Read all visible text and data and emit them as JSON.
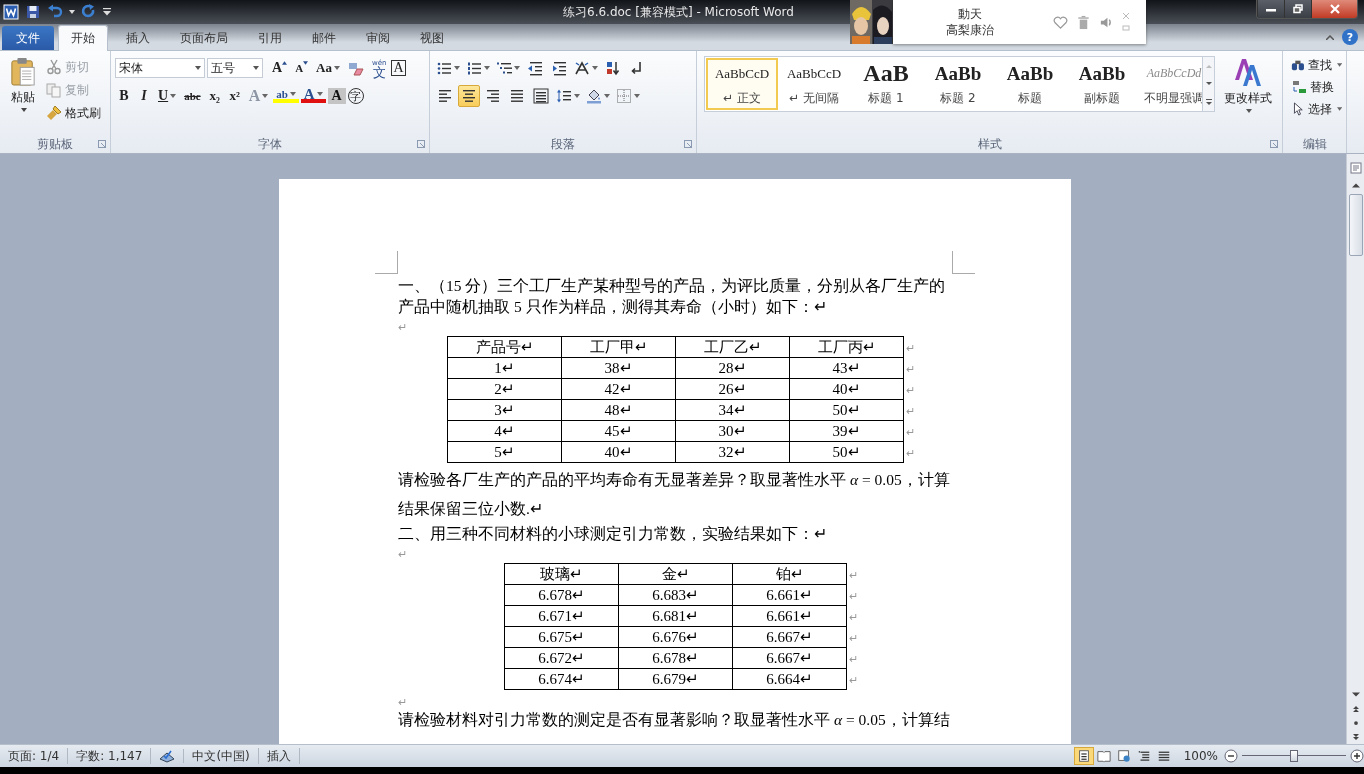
{
  "title_bar": {
    "title": "练习6.6.doc [兼容模式]  -  Microsoft Word"
  },
  "now_playing": {
    "title": "動天",
    "artist": "高梨康治"
  },
  "tabs": [
    {
      "label": "文件",
      "kind": "file",
      "selected": false
    },
    {
      "label": "开始",
      "kind": "tab",
      "selected": true
    },
    {
      "label": "插入",
      "kind": "tab",
      "selected": false
    },
    {
      "label": "页面布局",
      "kind": "tab",
      "selected": false
    },
    {
      "label": "引用",
      "kind": "tab",
      "selected": false
    },
    {
      "label": "邮件",
      "kind": "tab",
      "selected": false
    },
    {
      "label": "审阅",
      "kind": "tab",
      "selected": false
    },
    {
      "label": "视图",
      "kind": "tab",
      "selected": false
    }
  ],
  "help": "?",
  "clipboard": {
    "paste": "粘贴",
    "group": "剪贴板",
    "items": [
      {
        "label": "剪切",
        "kind": "cut",
        "disabled": true
      },
      {
        "label": "复制",
        "kind": "copy",
        "disabled": true
      },
      {
        "label": "格式刷",
        "kind": "painter",
        "disabled": false
      }
    ]
  },
  "font": {
    "family": "宋体",
    "size": "五号",
    "group": "字体",
    "row1": [
      {
        "label": "A",
        "kind": "grow"
      },
      {
        "label": "A",
        "kind": "shrink"
      },
      {
        "label": "Aa",
        "kind": "case"
      },
      {
        "kind": "clear"
      },
      {
        "label": "文",
        "ruby": "wén",
        "kind": "phonetic"
      },
      {
        "label": "A",
        "kind": "border"
      }
    ],
    "row2": [
      {
        "label": "B",
        "kind": "bold"
      },
      {
        "label": "I",
        "kind": "italic"
      },
      {
        "label": "U",
        "kind": "underline"
      },
      {
        "label": "abc",
        "kind": "strike"
      },
      {
        "label": "x₂",
        "kind": "sub"
      },
      {
        "label": "x²",
        "kind": "sup"
      },
      {
        "label": "A",
        "kind": "effect"
      },
      {
        "label": "ab",
        "kind": "highlight"
      },
      {
        "label": "A",
        "kind": "color"
      },
      {
        "label": "A",
        "kind": "shade"
      },
      {
        "label": "字",
        "kind": "enclose"
      }
    ]
  },
  "paragraph": {
    "group": "段落",
    "row1": [
      {
        "kind": "bullets"
      },
      {
        "kind": "numbering"
      },
      {
        "kind": "multilevel"
      },
      {
        "kind": "outdent"
      },
      {
        "kind": "indent"
      },
      {
        "kind": "asian"
      },
      {
        "kind": "sort"
      },
      {
        "kind": "marks"
      }
    ],
    "alignments": [
      {
        "kind": "left",
        "selected": false
      },
      {
        "kind": "center",
        "selected": true
      },
      {
        "kind": "right",
        "selected": false
      },
      {
        "kind": "justify",
        "selected": false
      },
      {
        "kind": "distribute",
        "selected": false
      }
    ],
    "row2": [
      {
        "kind": "linespacing"
      },
      {
        "kind": "shading"
      },
      {
        "kind": "borders"
      }
    ]
  },
  "styles": {
    "group": "样式",
    "change": "更改样式",
    "items": [
      {
        "preview": "AaBbCcD",
        "name": "↵ 正文",
        "kind": "normal",
        "selected": true
      },
      {
        "preview": "AaBbCcD",
        "name": "↵ 无间隔",
        "kind": "normal",
        "selected": false
      },
      {
        "preview": "AaB",
        "name": "标题 1",
        "kind": "title1",
        "selected": false
      },
      {
        "preview": "AaBb",
        "name": "标题 2",
        "kind": "title2",
        "selected": false
      },
      {
        "preview": "AaBb",
        "name": "标题",
        "kind": "title2",
        "selected": false
      },
      {
        "preview": "AaBb",
        "name": "副标题",
        "kind": "title2",
        "selected": false
      },
      {
        "preview": "AaBbCcDd",
        "name": "不明显强调",
        "kind": "subtle",
        "selected": false
      }
    ]
  },
  "editing": {
    "group": "编辑",
    "items": [
      {
        "label": "查找",
        "kind": "find"
      },
      {
        "label": "替换",
        "kind": "replace"
      },
      {
        "label": "选择",
        "kind": "select"
      }
    ]
  },
  "document": [
    {
      "kind": "para",
      "text": "一、（15 分）三个工厂生产某种型号的产品，为评比质量，分别从各厂生产的产品中随机抽取 5 只作为样品，测得其寿命（小时）如下：↵"
    },
    {
      "kind": "empty",
      "text": "↵"
    },
    {
      "kind": "table",
      "header": [
        "产品号↵",
        "工厂甲↵",
        "工厂乙↵",
        "工厂丙↵"
      ],
      "header_end": "↵",
      "rows": [
        {
          "cells": [
            "1↵",
            "38↵",
            "28↵",
            "43↵"
          ],
          "end": "↵"
        },
        {
          "cells": [
            "2↵",
            "42↵",
            "26↵",
            "40↵"
          ],
          "end": "↵"
        },
        {
          "cells": [
            "3↵",
            "48↵",
            "34↵",
            "50↵"
          ],
          "end": "↵"
        },
        {
          "cells": [
            "4↵",
            "45↵",
            "30↵",
            "39↵"
          ],
          "end": "↵"
        },
        {
          "cells": [
            "5↵",
            "40↵",
            "32↵",
            "50↵"
          ],
          "end": "↵"
        }
      ]
    },
    {
      "kind": "formula",
      "text": "请检验各厂生产的产品的平均寿命有无显著差异？取显著性水平 *α* = 0.05，计算结果保留三位小数.↵"
    },
    {
      "kind": "para",
      "text": "二、用三种不同材料的小球测定引力常数，实验结果如下：↵"
    },
    {
      "kind": "empty",
      "text": "↵"
    },
    {
      "kind": "table",
      "header": [
        "玻璃↵",
        "金↵",
        "铂↵"
      ],
      "header_end": "↵",
      "rows": [
        {
          "cells": [
            "6.678↵",
            "6.683↵",
            "6.661↵"
          ],
          "end": "↵"
        },
        {
          "cells": [
            "6.671↵",
            "6.681↵",
            "6.661↵"
          ],
          "end": "↵"
        },
        {
          "cells": [
            "6.675↵",
            "6.676↵",
            "6.667↵"
          ],
          "end": "↵"
        },
        {
          "cells": [
            "6.672↵",
            "6.678↵",
            "6.667↵"
          ],
          "end": "↵"
        },
        {
          "cells": [
            "6.674↵",
            "6.679↵",
            "6.664↵"
          ],
          "end": "↵"
        }
      ]
    },
    {
      "kind": "empty",
      "text": "↵"
    },
    {
      "kind": "para",
      "text": "请检验材料对引力常数的测定是否有显著影响？取显著性水平 *α* = 0.05，计算结"
    }
  ],
  "status_bar": {
    "page": "页面: 1/4",
    "words": "字数: 1,147",
    "language": "中文(中国)",
    "mode": "插入",
    "views": [
      {
        "kind": "print",
        "selected": true
      },
      {
        "kind": "reading",
        "selected": false
      },
      {
        "kind": "web",
        "selected": false
      },
      {
        "kind": "outline",
        "selected": false
      },
      {
        "kind": "draft",
        "selected": false
      }
    ],
    "zoom": "100%",
    "zoom_slider": {
      "level": 0.5
    }
  }
}
